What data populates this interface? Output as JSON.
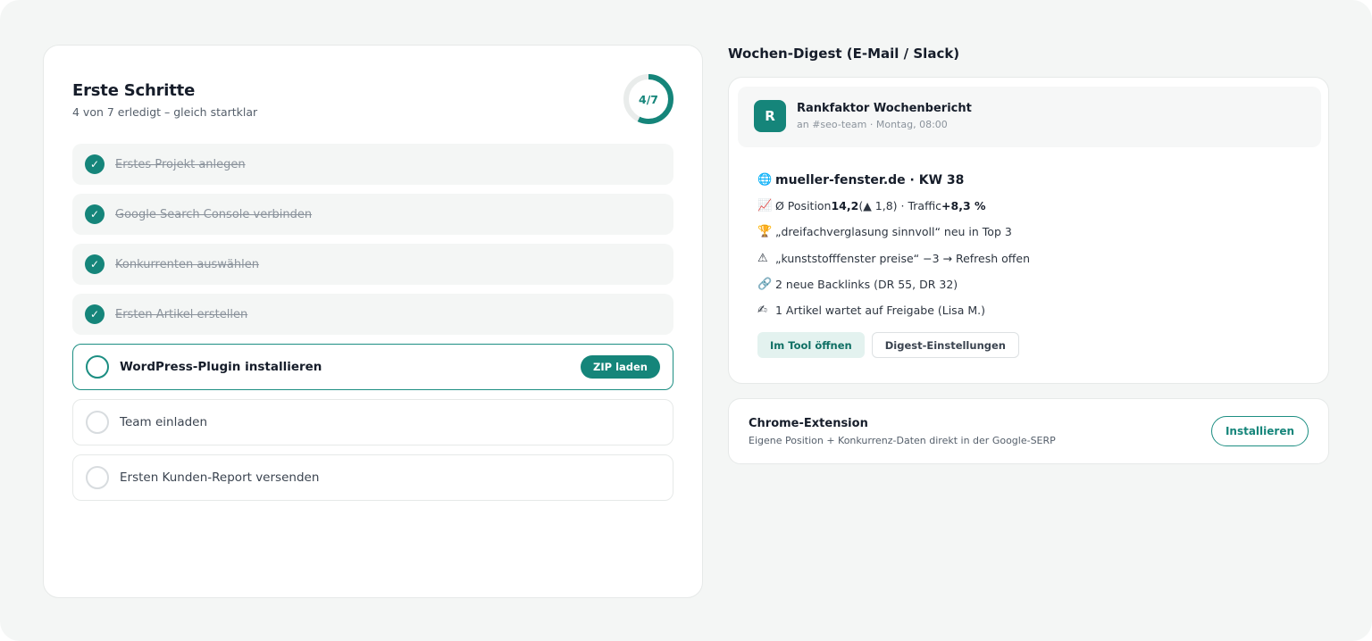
{
  "onboarding": {
    "title": "Erste Schritte",
    "subtitle": "4 von 7 erledigt – gleich startklar",
    "progress_label": "4/7",
    "progress_done": 4,
    "progress_total": 7,
    "steps": [
      {
        "label": "Erstes Projekt anlegen",
        "status": "done"
      },
      {
        "label": "Google Search Console verbinden",
        "status": "done"
      },
      {
        "label": "Konkurrenten auswählen",
        "status": "done"
      },
      {
        "label": "Ersten Artikel erstellen",
        "status": "done"
      },
      {
        "label": "WordPress-Plugin installieren",
        "status": "active",
        "action": "ZIP laden"
      },
      {
        "label": "Team einladen",
        "status": "open"
      },
      {
        "label": "Ersten Kunden-Report versenden",
        "status": "open"
      }
    ],
    "check_glyph": "✓"
  },
  "digest": {
    "heading": "Wochen-Digest (E-Mail / Slack)",
    "avatar_letter": "R",
    "message_title": "Rankfaktor Wochenbericht",
    "message_meta": "an #seo-team · Montag, 08:00",
    "lines": {
      "domain_icon": "🌐",
      "domain": "mueller-fenster.de · KW 38",
      "position_icon": "📈",
      "position_prefix": "Ø Position ",
      "position_value": "14,2",
      "position_change": " (▲ 1,8) · Traffic ",
      "traffic_value": "+8,3 %",
      "top3_icon": "🏆",
      "top3_text": "„dreifachverglasung sinnvoll“ neu in Top 3",
      "warning_icon": "⚠",
      "warning_text": "„kunststofffenster preise“ −3 → Refresh offen",
      "backlinks_icon": "🔗",
      "backlinks_text": "2 neue Backlinks (DR 55, DR 32)",
      "approval_icon": "✍",
      "approval_text": "1 Artikel wartet auf Freigabe (Lisa M.)"
    },
    "open_tool_label": "Im Tool öffnen",
    "settings_label": "Digest-Einstellungen"
  },
  "extension": {
    "title": "Chrome-Extension",
    "subtitle": "Eigene Position + Konkurrenz-Daten direkt in der Google-SERP",
    "install_label": "Installieren"
  },
  "colors": {
    "accent": "#15857a",
    "ring_track": "#e9eceb"
  }
}
